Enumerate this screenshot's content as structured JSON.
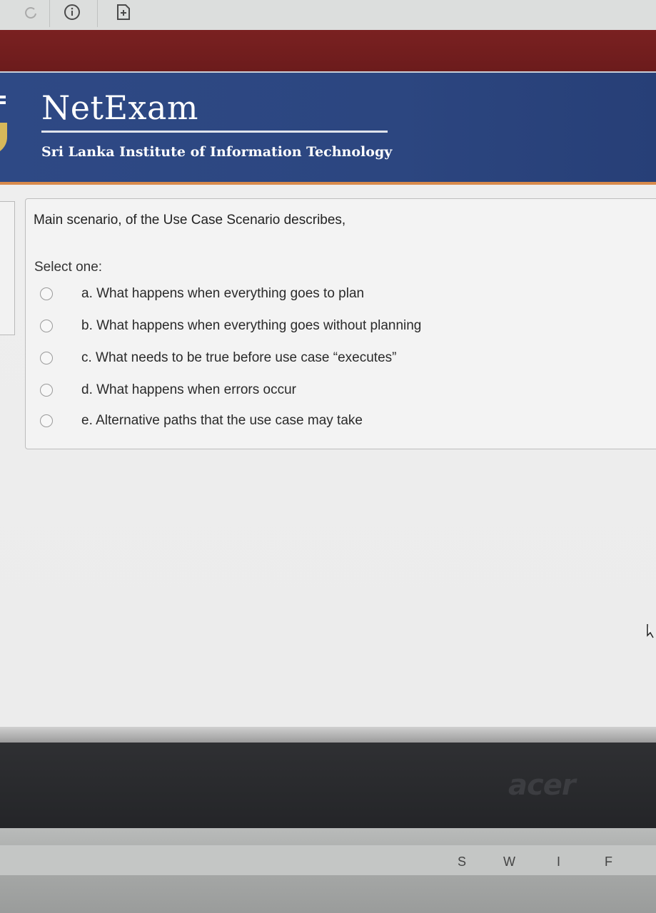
{
  "toolbar": {
    "icons": [
      "reload-icon",
      "info-icon",
      "new-tab-icon"
    ]
  },
  "header": {
    "brand": "NetExam",
    "institute": "Sri Lanka Institute of Information Technology"
  },
  "question": {
    "text": "Main scenario, of the Use Case Scenario describes,",
    "select_label": "Select one:",
    "options": [
      {
        "label": "a. What happens when everything goes to plan"
      },
      {
        "label": "b. What happens when everything goes without planning"
      },
      {
        "label": "c. What needs to be true before use case “executes”"
      },
      {
        "label": "d. What happens when errors occur"
      },
      {
        "label": "e. Alternative paths that the use case may take"
      }
    ]
  },
  "laptop": {
    "brand": "acer",
    "keys": [
      "S",
      "W",
      "I",
      "F"
    ]
  },
  "colors": {
    "header_blue": "#2e4985",
    "red_band": "#7a2121",
    "orange_accent": "#d88a4c"
  }
}
